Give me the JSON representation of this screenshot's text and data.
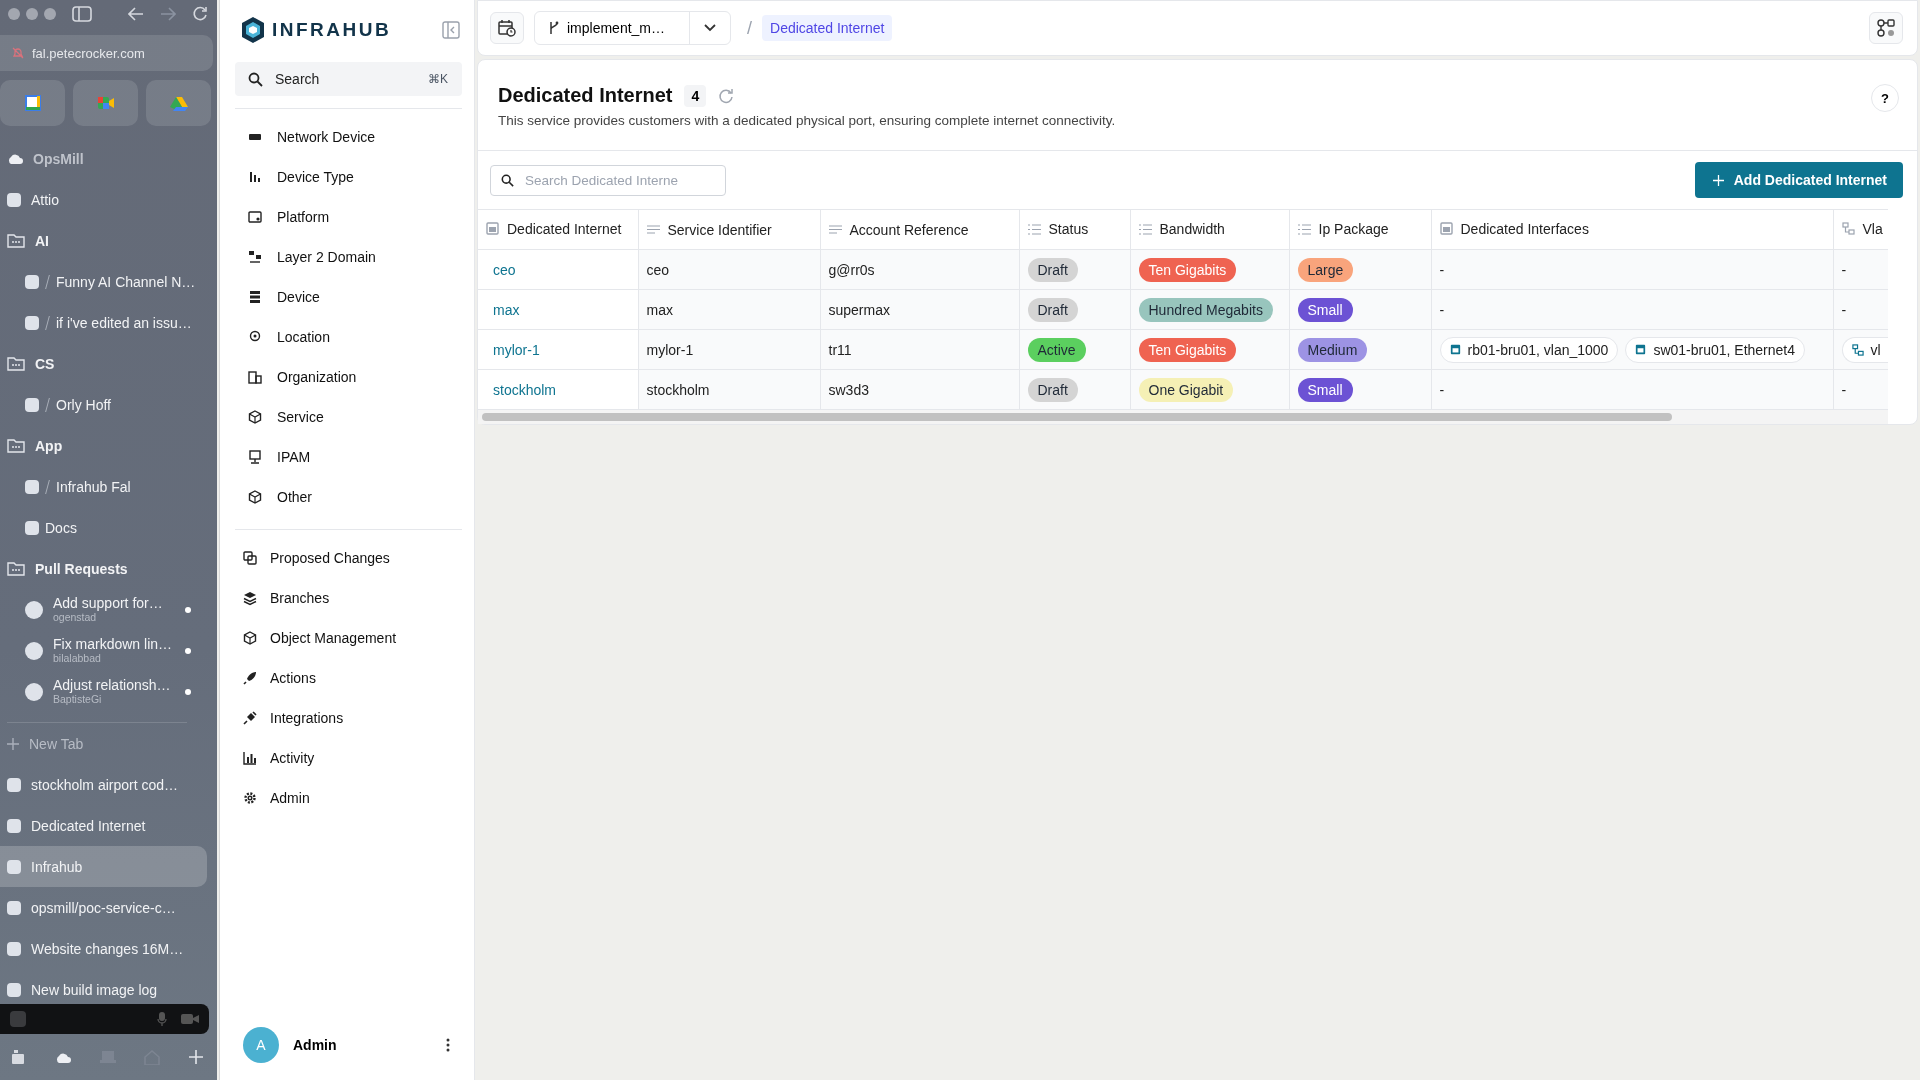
{
  "browser": {
    "url": "fal.petecrocker.com",
    "sidebar": [
      {
        "kind": "space",
        "label": "OpsMill"
      },
      {
        "kind": "tab",
        "label": "Attio",
        "selected": false
      },
      {
        "kind": "folder",
        "label": "AI",
        "children": [
          {
            "kind": "link",
            "label": "Funny AI Channel N…",
            "moved": true
          },
          {
            "kind": "link",
            "label": "if i've edited an issu…",
            "moved": true
          }
        ]
      },
      {
        "kind": "folder",
        "label": "CS",
        "children": [
          {
            "kind": "link",
            "label": "Orly Hoff",
            "moved": true
          }
        ]
      },
      {
        "kind": "folder",
        "label": "App",
        "children": [
          {
            "kind": "link",
            "label": "Infrahub Fal",
            "moved": true
          },
          {
            "kind": "link",
            "label": "Docs",
            "moved": false
          }
        ]
      },
      {
        "kind": "folder",
        "label": "Pull Requests",
        "children": [
          {
            "kind": "pr",
            "label": "Add support for…",
            "author": "ogenstad",
            "unread": true
          },
          {
            "kind": "pr",
            "label": "Fix markdown lin…",
            "author": "bilalabbad",
            "unread": true
          },
          {
            "kind": "pr",
            "label": "Adjust relationsh…",
            "author": "BaptisteGi",
            "unread": true
          }
        ]
      },
      {
        "kind": "new_tab",
        "label": "New Tab"
      },
      {
        "kind": "tab",
        "label": "stockholm airport cod…",
        "selected": false
      },
      {
        "kind": "tab",
        "label": "Dedicated Internet",
        "selected": false
      },
      {
        "kind": "tab",
        "label": "Infrahub",
        "selected": true
      },
      {
        "kind": "tab",
        "label": "opsmill/poc-service-c…",
        "selected": false
      },
      {
        "kind": "tab",
        "label": "Website changes 16M…",
        "selected": false
      },
      {
        "kind": "tab",
        "label": "New build image log",
        "selected": false
      }
    ]
  },
  "app": {
    "brand": "INFRAHUB",
    "search": {
      "placeholder": "Search",
      "shortcut": "⌘K"
    },
    "nav_groups": [
      [
        {
          "label": "Network Device"
        },
        {
          "label": "Device Type"
        },
        {
          "label": "Platform"
        },
        {
          "label": "Layer 2 Domain"
        },
        {
          "label": "Device"
        },
        {
          "label": "Location"
        },
        {
          "label": "Organization"
        },
        {
          "label": "Service"
        },
        {
          "label": "IPAM"
        },
        {
          "label": "Other"
        }
      ],
      [
        {
          "label": "Proposed Changes"
        },
        {
          "label": "Branches"
        },
        {
          "label": "Object Management"
        },
        {
          "label": "Actions"
        },
        {
          "label": "Integrations"
        },
        {
          "label": "Activity"
        },
        {
          "label": "Admin"
        }
      ]
    ],
    "user": {
      "initial": "A",
      "name": "Admin"
    }
  },
  "topbar": {
    "branch": "implement_m…",
    "separator": "/",
    "breadcrumb": "Dedicated Internet"
  },
  "page": {
    "title": "Dedicated Internet",
    "count": "4",
    "description": "This service provides customers with a dedicated physical port, ensuring complete internet connectivity.",
    "help": "?",
    "search_placeholder": "Search Dedicated Interne",
    "add_button": "Add Dedicated Internet"
  },
  "table": {
    "columns": [
      {
        "label": "Dedicated Internet",
        "kind": "node"
      },
      {
        "label": "Service Identifier",
        "kind": "text"
      },
      {
        "label": "Account Reference",
        "kind": "text"
      },
      {
        "label": "Status",
        "kind": "dropdown"
      },
      {
        "label": "Bandwidth",
        "kind": "dropdown"
      },
      {
        "label": "Ip Package",
        "kind": "dropdown"
      },
      {
        "label": "Dedicated Interfaces",
        "kind": "node"
      },
      {
        "label": "Vla",
        "kind": "relation"
      }
    ],
    "rows": [
      {
        "name": "ceo",
        "service_identifier": "ceo",
        "account_reference": "g@rr0s",
        "status": {
          "label": "Draft",
          "color": "#d4d4d4"
        },
        "bandwidth": {
          "label": "Ten Gigabits",
          "color": "#ef6351"
        },
        "ip_package": {
          "label": "Large",
          "color": "#f9a47c"
        },
        "interfaces": "-",
        "vlan": "-"
      },
      {
        "name": "max",
        "service_identifier": "max",
        "account_reference": "supermax",
        "status": {
          "label": "Draft",
          "color": "#d4d4d4"
        },
        "bandwidth": {
          "label": "Hundred Megabits",
          "color": "#98c5bd"
        },
        "ip_package": {
          "label": "Small",
          "color": "#6c52d4"
        },
        "interfaces": "-",
        "vlan": "-"
      },
      {
        "name": "mylor-1",
        "service_identifier": "mylor-1",
        "account_reference": "tr11",
        "status": {
          "label": "Active",
          "color": "#5bcf5f"
        },
        "bandwidth": {
          "label": "Ten Gigabits",
          "color": "#ef6351"
        },
        "ip_package": {
          "label": "Medium",
          "color": "#9d93e4"
        },
        "interfaces": [
          "rb01-bru01, vlan_1000",
          "sw01-bru01, Ethernet4"
        ],
        "vlan": [
          "vl"
        ]
      },
      {
        "name": "stockholm",
        "service_identifier": "stockholm",
        "account_reference": "sw3d3",
        "status": {
          "label": "Draft",
          "color": "#d4d4d4"
        },
        "bandwidth": {
          "label": "One Gigabit",
          "color": "#f5f0b5"
        },
        "ip_package": {
          "label": "Small",
          "color": "#6c52d4"
        },
        "interfaces": "-",
        "vlan": "-"
      }
    ]
  }
}
